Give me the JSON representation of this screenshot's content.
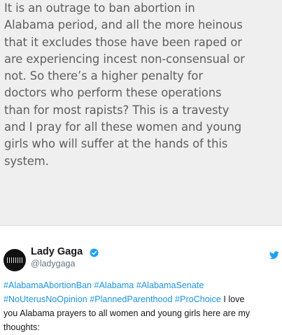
{
  "notes": {
    "lines": [
      "It is an outrage to ban abortion in",
      "Alabama period, and all the more heinous",
      "that it excludes those have been raped or",
      "are experiencing incest non-consensual or",
      "not. So there’s a higher penalty for",
      "doctors who perform these operations",
      "than for most rapists? This is a travesty",
      "and I pray for all these women and young",
      "girls who will suffer at the hands of this",
      "system."
    ]
  },
  "tweet": {
    "display_name": "Lady Gaga",
    "handle": "@ladygaga",
    "verified_icon": "verified-badge-icon",
    "platform_icon": "twitter-bird-icon",
    "body": [
      {
        "hashtag": "#AlabamaAbortionBan",
        "sep1": " ",
        "hashtag2": "#Alabama",
        "sep2": " ",
        "hashtag3": "#AlabamaSenate"
      },
      {
        "hashtag": "#NoUterusNoOpinion",
        "sep1": " ",
        "hashtag2": "#PlannedParenthood",
        "sep2": " ",
        "hashtag3": "#ProChoice",
        "text": " I love"
      }
    ],
    "text_line3": "you Alabama prayers to all women and young girls here are my",
    "text_line4": "thoughts:"
  },
  "colors": {
    "hashtag": "#1b95e0",
    "verified": "#1da1f2",
    "notes_background": "#efefef",
    "notes_text": "#5f5f5f"
  }
}
